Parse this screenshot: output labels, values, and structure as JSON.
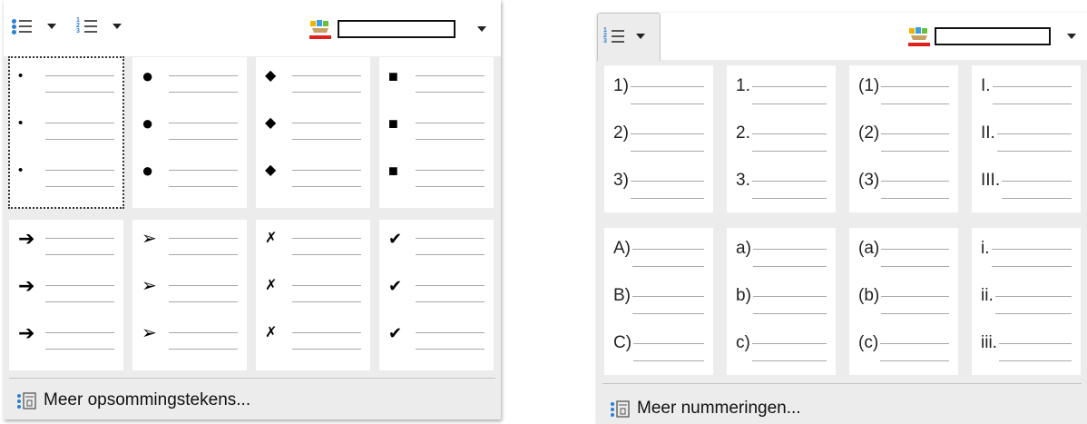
{
  "bullets_panel": {
    "toolbar": {
      "bullet_list_button": {
        "icon": "bullet-list-icon"
      },
      "numbered_list_button": {
        "icon": "numbered-list-icon"
      },
      "color": {
        "icon": "highlight-color-icon",
        "value": "#ffffff",
        "underline": "#e0201b"
      }
    },
    "markers_row1": [
      "•",
      "●",
      "◆",
      "■"
    ],
    "markers_row2": [
      "➔",
      "➢",
      "✗",
      "✔"
    ],
    "more_label": "Meer opsommingstekens..."
  },
  "numbering_panel": {
    "toolbar": {
      "numbered_list_button": {
        "icon": "numbered-list-icon"
      },
      "color": {
        "icon": "highlight-color-icon",
        "value": "#ffffff",
        "underline": "#e0201b"
      }
    },
    "row1": [
      [
        "1)",
        "2)",
        "3)"
      ],
      [
        "1.",
        "2.",
        "3."
      ],
      [
        "(1)",
        "(2)",
        "(3)"
      ],
      [
        "I.",
        "II.",
        "III."
      ]
    ],
    "row2": [
      [
        "A)",
        "B)",
        "C)"
      ],
      [
        "a)",
        "b)",
        "c)"
      ],
      [
        "(a)",
        "(b)",
        "(c)"
      ],
      [
        "i.",
        "ii.",
        "iii."
      ]
    ],
    "more_label": "Meer nummeringen..."
  }
}
